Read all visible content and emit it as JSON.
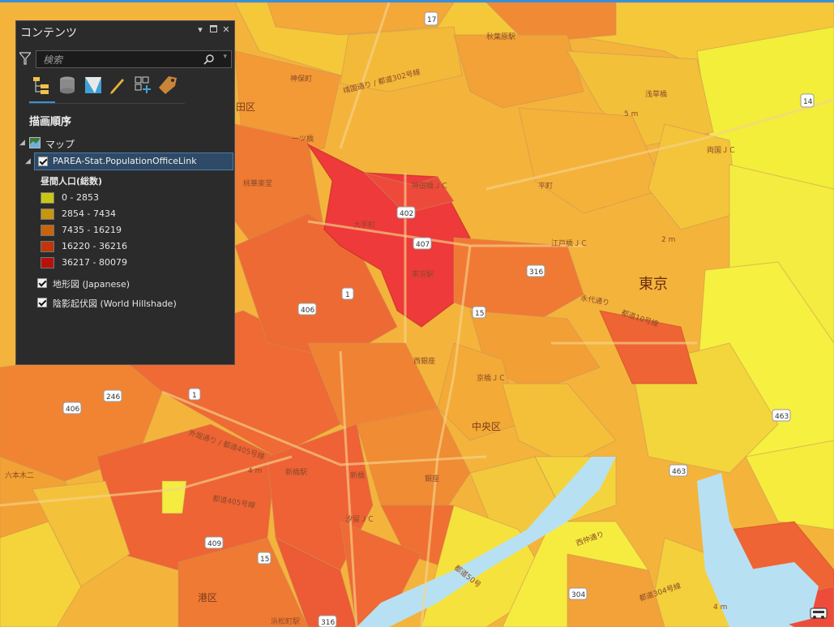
{
  "contents_pane": {
    "title": "コンテンツ",
    "search_placeholder": "検索",
    "section_title": "描画順序",
    "map_node": "マップ",
    "layer": {
      "name": "PAREA-Stat.PopulationOfficeLink",
      "checked": true,
      "legend_title": "昼間人口(総数)",
      "classes": [
        {
          "label": "0 - 2853",
          "color": "#c8c814"
        },
        {
          "label": "2854 - 7434",
          "color": "#c8960e"
        },
        {
          "label": "7435 - 16219",
          "color": "#c8640a"
        },
        {
          "label": "16220 - 36216",
          "color": "#c0360a"
        },
        {
          "label": "36217 - 80079",
          "color": "#b8100a"
        }
      ]
    },
    "basemaps": [
      {
        "label": "地形図 (Japanese)",
        "checked": true
      },
      {
        "label": "陰影起伏図 (World Hillshade)",
        "checked": true
      }
    ]
  },
  "map_labels": {
    "district_tokyo": "東京",
    "chuo_ku": "中央区",
    "minato_ku": "港区",
    "ku_partial": "田区",
    "otemachi": "大手町",
    "jimbocho": "神保町",
    "akihabara": "秋葉原駅",
    "kanda_jc": "神田橋ＪＣ",
    "edobashi_jc": "江戸橋ＪＣ",
    "kyobashi_jc": "京橋ＪＣ",
    "shiodome_jc": "汐留ＪＣ",
    "ryogoku_jc": "両国ＪＣ",
    "tokyo_station": "東京駅",
    "nishiginza": "西銀座",
    "shinbashi": "新橋",
    "shinbashi_station": "新橋駅",
    "ginza": "銀座",
    "hamamatsucho": "浜松町駅",
    "roppongi": "六本木二",
    "momijiyama": "桃華楽堂",
    "asakusabashi": "浅草橋",
    "hitotsubashi": "一ツ橋",
    "eitai_dori": "永代通り",
    "shuto_10": "都道10号線",
    "shuto_405": "都道405号線",
    "gaien_dori": "外堀通り / 都道405号線",
    "yasukuni": "靖国通り / 都道302号線",
    "tokyo_route_50": "都道50号",
    "route_304": "都道304号線",
    "sanbancho": "平町",
    "nishi_dori": "西仲通り",
    "m5": "5 m",
    "m2": "2 m",
    "m4a": "4 m",
    "m4b": "4 m",
    "routes": [
      "17",
      "14",
      "402",
      "407",
      "316",
      "1",
      "406",
      "15",
      "246",
      "406",
      "1",
      "463",
      "463",
      "409",
      "15",
      "316",
      "304",
      "4"
    ]
  }
}
